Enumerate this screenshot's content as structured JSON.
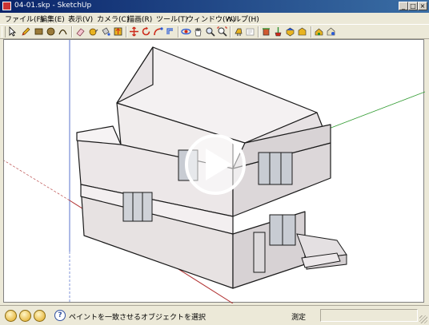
{
  "window": {
    "title": "04-01.skp - SketchUp",
    "controls": {
      "minimize": "_",
      "maximize": "□",
      "close": "×"
    }
  },
  "menu": {
    "items": [
      {
        "label": "ファイル(F)"
      },
      {
        "label": "編集(E)"
      },
      {
        "label": "表示(V)"
      },
      {
        "label": "カメラ(C)"
      },
      {
        "label": "描画(R)"
      },
      {
        "label": "ツール(T)"
      },
      {
        "label": "ウィンドウ(W)"
      },
      {
        "label": "ヘルプ(H)"
      }
    ]
  },
  "toolbar": {
    "tools": [
      "select-icon",
      "pencil-icon",
      "rectangle-icon",
      "circle-icon",
      "arc-icon",
      "eraser-icon",
      "tape-icon",
      "paint-bucket-icon",
      "push-pull-icon",
      "move-icon",
      "rotate-icon",
      "follow-me-icon",
      "orbit-icon",
      "pan-icon",
      "zoom-icon",
      "zoom-extents-icon",
      "walk-icon",
      "look-around-icon",
      "section-icon",
      "components-icon",
      "model-info-icon",
      "warehouse-icon",
      "share-icon",
      "get-models-icon"
    ],
    "colors": {
      "accent_red": "#cc2a1a",
      "accent_blue": "#2a5bd7",
      "accent_yellow": "#e8b320",
      "accent_green": "#2f8f2f"
    }
  },
  "status": {
    "hint": "ペイントを一致させるオブジェクトを選択",
    "measurement_label": "測定",
    "measurement_value": "",
    "help_glyph": "?"
  },
  "viewport": {
    "background": "#ffffff",
    "axes": {
      "red": "#b03030",
      "green": "#2e9a2e",
      "blue": "#3050c0"
    },
    "play_overlay": "play-button-icon"
  }
}
